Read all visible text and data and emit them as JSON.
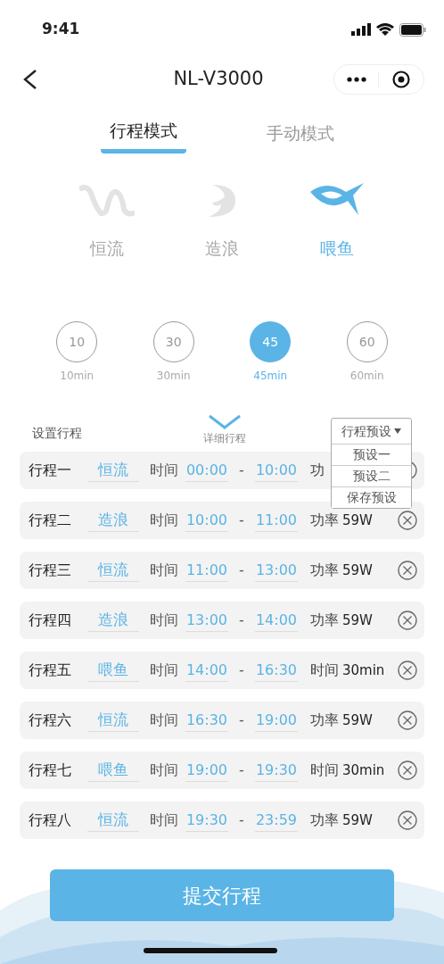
{
  "status_bar": {
    "time": "9:41"
  },
  "nav": {
    "title": "NL-V3000"
  },
  "tabs": [
    {
      "label": "行程模式",
      "selected": true
    },
    {
      "label": "手动模式",
      "selected": false
    }
  ],
  "modes": [
    {
      "kind": "wave",
      "label": "恒流",
      "selected": false
    },
    {
      "kind": "surf",
      "label": "造浪",
      "selected": false
    },
    {
      "kind": "fish",
      "label": "喂鱼",
      "selected": true
    }
  ],
  "durations": [
    {
      "value": "10",
      "label": "10min",
      "selected": false
    },
    {
      "value": "30",
      "label": "30min",
      "selected": false
    },
    {
      "value": "45",
      "label": "45min",
      "selected": true
    },
    {
      "value": "60",
      "label": "60min",
      "selected": false
    }
  ],
  "schedule": {
    "title": "设置行程",
    "detail_label": "详细行程",
    "preset_menu": {
      "label": "行程预设",
      "expanded": true,
      "options": [
        "预设一",
        "预设二",
        "保存预设"
      ]
    },
    "rows": [
      {
        "name": "行程一",
        "mode": "恒流",
        "time_label": "时间",
        "start": "00:00",
        "end": "10:00",
        "separator": "-",
        "param_label": "功"
      },
      {
        "name": "行程二",
        "mode": "造浪",
        "time_label": "时间",
        "start": "10:00",
        "end": "11:00",
        "separator": "-",
        "param_label": "功率",
        "param_value": "59W"
      },
      {
        "name": "行程三",
        "mode": "恒流",
        "time_label": "时间",
        "start": "11:00",
        "end": "13:00",
        "separator": "-",
        "param_label": "功率",
        "param_value": "59W"
      },
      {
        "name": "行程四",
        "mode": "造浪",
        "time_label": "时间",
        "start": "13:00",
        "end": "14:00",
        "separator": "-",
        "param_label": "功率",
        "param_value": "59W"
      },
      {
        "name": "行程五",
        "mode": "喂鱼",
        "time_label": "时间",
        "start": "14:00",
        "end": "16:30",
        "separator": "-",
        "param_label": "时间",
        "param_value": "30min"
      },
      {
        "name": "行程六",
        "mode": "恒流",
        "time_label": "时间",
        "start": "16:30",
        "end": "19:00",
        "separator": "-",
        "param_label": "功率",
        "param_value": "59W"
      },
      {
        "name": "行程七",
        "mode": "喂鱼",
        "time_label": "时间",
        "start": "19:00",
        "end": "19:30",
        "separator": "-",
        "param_label": "时间",
        "param_value": "30min"
      },
      {
        "name": "行程八",
        "mode": "恒流",
        "time_label": "时间",
        "start": "19:30",
        "end": "23:59",
        "separator": "-",
        "param_label": "功率",
        "param_value": "59W"
      }
    ]
  },
  "submit_button": "提交行程"
}
